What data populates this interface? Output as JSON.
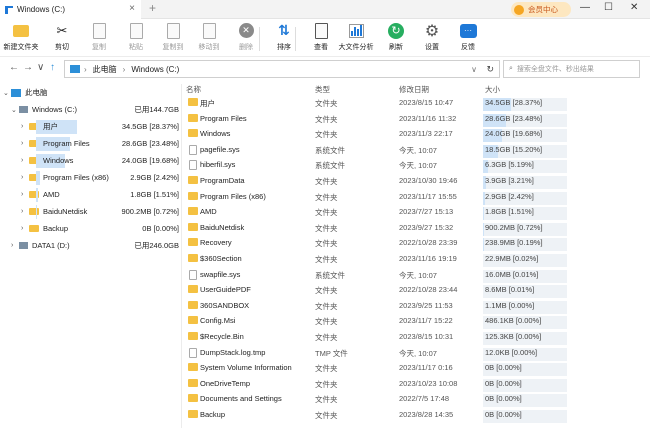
{
  "tab": {
    "title": "Windows (C:)",
    "close": "×",
    "add": "+"
  },
  "vip": {
    "label": "会员中心"
  },
  "window": {
    "minimize": "—",
    "maximize": "☐",
    "close": "✕"
  },
  "toolbar": [
    {
      "label": "新建文件夹",
      "disabled": false,
      "icon": "new-folder-icon"
    },
    {
      "label": "剪切",
      "disabled": false,
      "icon": "scissors-icon"
    },
    {
      "label": "复制",
      "disabled": true,
      "icon": "copy-icon"
    },
    {
      "label": "粘贴",
      "disabled": true,
      "icon": "paste-icon"
    },
    {
      "label": "复制到",
      "disabled": true,
      "icon": "copy-to-icon"
    },
    {
      "label": "移动到",
      "disabled": true,
      "icon": "move-to-icon"
    },
    {
      "label": "删除",
      "disabled": true,
      "icon": "delete-icon"
    },
    {
      "label": "排序",
      "disabled": false,
      "icon": "sort-icon"
    },
    {
      "label": "查看",
      "disabled": false,
      "icon": "view-icon"
    },
    {
      "label": "大文件分析",
      "disabled": false,
      "icon": "analysis-icon"
    },
    {
      "label": "刷新",
      "disabled": false,
      "icon": "refresh-icon"
    },
    {
      "label": "设置",
      "disabled": false,
      "icon": "gear-icon"
    },
    {
      "label": "反馈",
      "disabled": false,
      "icon": "feedback-icon"
    }
  ],
  "address": {
    "root": "此电脑",
    "current": "Windows (C:)"
  },
  "search": {
    "placeholder": "搜索全盘文件、秒出结果"
  },
  "tree": {
    "root": "此电脑",
    "drive_c": {
      "name": "Windows (C:)",
      "used": "已用144.7GB"
    },
    "folders": [
      {
        "name": "用户",
        "size": "34.5GB [28.37%]",
        "pct": 28.37
      },
      {
        "name": "Program Files",
        "size": "28.6GB [23.48%]",
        "pct": 23.48
      },
      {
        "name": "Windows",
        "size": "24.0GB [19.68%]",
        "pct": 19.68
      },
      {
        "name": "Program Files (x86)",
        "size": "2.9GB [2.42%]",
        "pct": 2.42
      },
      {
        "name": "AMD",
        "size": "1.8GB [1.51%]",
        "pct": 1.51
      },
      {
        "name": "BaiduNetdisk",
        "size": "900.2MB [0.72%]",
        "pct": 0.72
      },
      {
        "name": "Backup",
        "size": "0B [0.00%]",
        "pct": 0
      }
    ],
    "drive_d": {
      "name": "DATA1 (D:)",
      "used": "已用246.0GB"
    }
  },
  "columns": {
    "name": "名称",
    "type": "类型",
    "date": "修改日期",
    "size": "大小"
  },
  "files": [
    {
      "name": "用户",
      "type": "文件夹",
      "date": "2023/8/15 10:47",
      "size": "34.5GB [28.37%]",
      "pct": 28.37,
      "folder": true
    },
    {
      "name": "Program Files",
      "type": "文件夹",
      "date": "2023/11/16 11:32",
      "size": "28.6GB [23.48%]",
      "pct": 23.48,
      "folder": true
    },
    {
      "name": "Windows",
      "type": "文件夹",
      "date": "2023/11/3 22:17",
      "size": "24.0GB [19.68%]",
      "pct": 19.68,
      "folder": true
    },
    {
      "name": "pagefile.sys",
      "type": "系统文件",
      "date": "今天, 10:07",
      "size": "18.5GB [15.20%]",
      "pct": 15.2,
      "folder": false
    },
    {
      "name": "hiberfil.sys",
      "type": "系统文件",
      "date": "今天, 10:07",
      "size": "6.3GB [5.19%]",
      "pct": 5.19,
      "folder": false
    },
    {
      "name": "ProgramData",
      "type": "文件夹",
      "date": "2023/10/30 19:46",
      "size": "3.9GB [3.21%]",
      "pct": 3.21,
      "folder": true
    },
    {
      "name": "Program Files (x86)",
      "type": "文件夹",
      "date": "2023/11/17 15:55",
      "size": "2.9GB [2.42%]",
      "pct": 2.42,
      "folder": true
    },
    {
      "name": "AMD",
      "type": "文件夹",
      "date": "2023/7/27 15:13",
      "size": "1.8GB [1.51%]",
      "pct": 1.51,
      "folder": true
    },
    {
      "name": "BaiduNetdisk",
      "type": "文件夹",
      "date": "2023/9/27 15:32",
      "size": "900.2MB [0.72%]",
      "pct": 0.72,
      "folder": true
    },
    {
      "name": "Recovery",
      "type": "文件夹",
      "date": "2022/10/28 23:39",
      "size": "238.9MB [0.19%]",
      "pct": 0.19,
      "folder": true
    },
    {
      "name": "$360Section",
      "type": "文件夹",
      "date": "2023/11/16 19:19",
      "size": "22.9MB [0.02%]",
      "pct": 0.02,
      "folder": true
    },
    {
      "name": "swapfile.sys",
      "type": "系统文件",
      "date": "今天, 10:07",
      "size": "16.0MB [0.01%]",
      "pct": 0.01,
      "folder": false
    },
    {
      "name": "UserGuidePDF",
      "type": "文件夹",
      "date": "2022/10/28 23:44",
      "size": "8.6MB [0.01%]",
      "pct": 0.01,
      "folder": true
    },
    {
      "name": "360SANDBOX",
      "type": "文件夹",
      "date": "2023/9/25 11:53",
      "size": "1.1MB [0.00%]",
      "pct": 0,
      "folder": true
    },
    {
      "name": "Config.Msi",
      "type": "文件夹",
      "date": "2023/11/7 15:22",
      "size": "486.1KB [0.00%]",
      "pct": 0,
      "folder": true
    },
    {
      "name": "$Recycle.Bin",
      "type": "文件夹",
      "date": "2023/8/15 10:31",
      "size": "125.3KB [0.00%]",
      "pct": 0,
      "folder": true
    },
    {
      "name": "DumpStack.log.tmp",
      "type": "TMP 文件",
      "date": "今天, 10:07",
      "size": "12.0KB [0.00%]",
      "pct": 0,
      "folder": false
    },
    {
      "name": "System Volume Information",
      "type": "文件夹",
      "date": "2023/11/17 0:16",
      "size": "0B [0.00%]",
      "pct": 0,
      "folder": true
    },
    {
      "name": "OneDriveTemp",
      "type": "文件夹",
      "date": "2023/10/23 10:08",
      "size": "0B [0.00%]",
      "pct": 0,
      "folder": true
    },
    {
      "name": "Documents and Settings",
      "type": "文件夹",
      "date": "2022/7/5 17:48",
      "size": "0B [0.00%]",
      "pct": 0,
      "folder": true
    },
    {
      "name": "Backup",
      "type": "文件夹",
      "date": "2023/8/28 14:35",
      "size": "0B [0.00%]",
      "pct": 0,
      "folder": true
    }
  ]
}
